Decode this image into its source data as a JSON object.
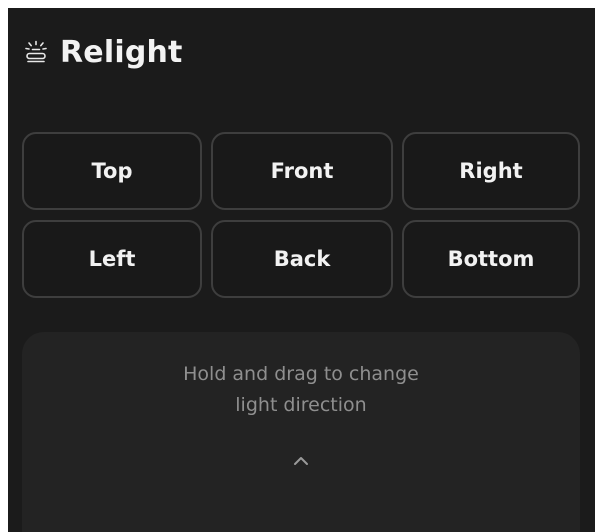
{
  "panel": {
    "title": "Relight",
    "icon": "relight-lamp-icon"
  },
  "directions": [
    {
      "label": "Top"
    },
    {
      "label": "Front"
    },
    {
      "label": "Right"
    },
    {
      "label": "Left"
    },
    {
      "label": "Back"
    },
    {
      "label": "Bottom"
    }
  ],
  "drag_area": {
    "line1": "Hold and drag to change",
    "line2": "light direction",
    "icon": "chevron-up-icon"
  },
  "colors": {
    "background": "#1b1b1b",
    "button_border": "#3e3e3e",
    "drag_area": "#232323",
    "hint_text": "#8f8f8f",
    "text": "#f2f2f2"
  }
}
